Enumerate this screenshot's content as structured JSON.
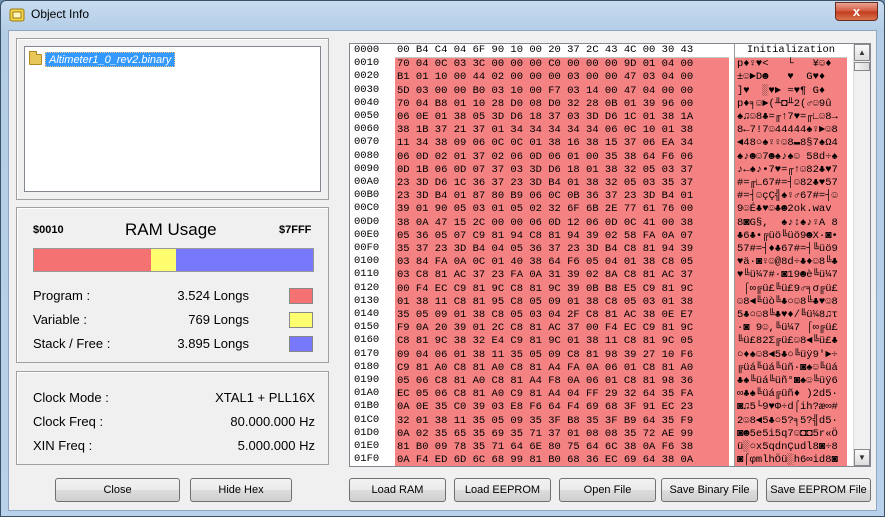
{
  "window": {
    "title": "Object Info",
    "close_glyph": "x"
  },
  "tree": {
    "item_label": "Altimeter1_0_rev2.binary"
  },
  "ram": {
    "start": "$0010",
    "title": "RAM Usage",
    "end": "$7FFF",
    "usage": {
      "program": 0.42,
      "variable": 0.09,
      "stack": 0.49
    },
    "colors": {
      "program": "#f47272",
      "variable": "#fdfd6e",
      "stack": "#7878fc"
    },
    "rows": [
      {
        "label": "Program :",
        "value": "3.524 Longs"
      },
      {
        "label": "Variable :",
        "value": "769 Longs"
      },
      {
        "label": "Stack / Free :",
        "value": "3.895 Longs"
      }
    ]
  },
  "clock": {
    "rows": [
      {
        "label": "Clock Mode :",
        "value": "XTAL1 + PLL16X"
      },
      {
        "label": "Clock Freq :",
        "value": "80.000.000 Hz"
      },
      {
        "label": "XIN Freq :",
        "value": "5.000.000 Hz"
      }
    ]
  },
  "hex": {
    "ascii_header": "Initialization",
    "rows": [
      {
        "addr": "0000",
        "bytes": "00 B4 C4 04 6F 90 10 00 20 37 2C 43 4C 00 30 43",
        "ascii": ""
      },
      {
        "addr": "0010",
        "bytes": "70 04 0C 03 3C 00 00 00 C0 00 00 00 9D 01 04 00",
        "ascii": "p♦♀♥<   └   ¥☺♦ "
      },
      {
        "addr": "0020",
        "bytes": "B1 01 10 00 44 02 00 00 00 03 00 00 47 03 04 00",
        "ascii": "±☺►D☻   ♥  G♥♦ "
      },
      {
        "addr": "0030",
        "bytes": "5D 03 00 00 B0 03 10 00 F7 03 14 00 47 04 00 00",
        "ascii": "]♥  ░♥► ≈♥¶ G♦  "
      },
      {
        "addr": "0040",
        "7": "",
        "bytes": "70 04 B8 01 10 28 D0 08 D0 32 28 0B 01 39 96 00",
        "ascii": "p♦╕☺►(╨◘╨2(♂☺9û "
      },
      {
        "addr": "0050",
        "bytes": "06 0E 01 38 05 3D D6 18 37 03 3D D6 1C 01 38 1A",
        "ascii": "♠♫☺8♣=╓↑7♥=╓∟☺8→"
      },
      {
        "addr": "0060",
        "bytes": "38 1B 37 21 37 01 34 34 34 34 34 06 0C 10 01 38",
        "ascii": "8←7!7☺44444♠♀►☺8"
      },
      {
        "addr": "0070",
        "bytes": "11 34 38 09 06 0C 0C 01 38 16 38 15 37 06 EA 34",
        "ascii": "◄48○♠♀♀☺8▬8§7♠Ω4"
      },
      {
        "addr": "0080",
        "bytes": "06 0D 02 01 37 02 06 0D 06 01 00 35 38 64 F6 06",
        "ascii": "♠♪☻☺7☻♠♪♠☺ 58d÷♠"
      },
      {
        "addr": "0090",
        "bytes": "0D 1B 06 0D 07 37 03 3D D6 18 01 38 32 05 03 37",
        "ascii": "♪←♠♪•7♥=╓↑☺82♣♥7"
      },
      {
        "addr": "00A0",
        "bytes": "23 3D D6 1C 36 37 23 3D B4 01 38 32 05 03 35 37",
        "ascii": "#=╓∟67#=┤☺82♣♥57"
      },
      {
        "addr": "00B0",
        "bytes": "23 3D B4 01 87 80 B9 06 0C 0B 36 37 23 3D B4 01",
        "ascii": "#=┤☺çÇ╣♠♀♂67#=┤☺"
      },
      {
        "addr": "00C0",
        "bytes": "39 01 90 05 03 01 05 02 32 6F 6B 2E 77 61 76 00",
        "ascii": "9☺É♣♥☺♣☻2ok.wav "
      },
      {
        "addr": "00D0",
        "bytes": "38 0A 47 15 2C 00 00 06 0D 12 06 0D 0C 41 00 38",
        "ascii": "8◙G§,  ♠♪↕♠♪♀A 8"
      },
      {
        "addr": "00E0",
        "bytes": "05 36 05 07 C9 81 94 C8 81 94 39 02 58 FA 0A 07",
        "ascii": "♣6♣•╔üö╚üö9☻X·◙•"
      },
      {
        "addr": "00F0",
        "bytes": "35 37 23 3D B4 04 05 36 37 23 3D B4 C8 81 94 39",
        "ascii": "57#=┤♦♣67#=┤╚üö9"
      },
      {
        "addr": "0100",
        "bytes": "03 84 FA 0A 0C 01 40 38 64 F6 05 04 01 38 C8 05",
        "ascii": "♥ä·◙♀☺@8d÷♣♦☺8╚♣"
      },
      {
        "addr": "0110",
        "bytes": "03 C8 81 AC 37 23 FA 0A 31 39 02 8A C8 81 AC 37",
        "ascii": "♥╚ü¼7#·◙19☻è╚ü¼7"
      },
      {
        "addr": "0120",
        "bytes": "00 F4 EC C9 81 9C C8 81 9C 39 0B B8 E5 C9 81 9C",
        "ascii": " ⌠∞╔ü£╚ü£9♂╕σ╔ü£"
      },
      {
        "addr": "0130",
        "bytes": "01 38 11 C8 81 95 C8 05 09 01 38 C8 05 03 01 38",
        "ascii": "☺8◄╚üò╚♣○☺8╚♣♥☺8"
      },
      {
        "addr": "0140",
        "bytes": "35 05 09 01 38 C8 05 03 04 2F C8 81 AC 38 0E E7",
        "ascii": "5♣○☺8╚♣♥♦/╚ü¼8♫τ"
      },
      {
        "addr": "0150",
        "bytes": "F9 0A 20 39 01 2C C8 81 AC 37 00 F4 EC C9 81 9C",
        "ascii": "∙◙ 9☺,╚ü¼7 ⌠∞╔ü£"
      },
      {
        "addr": "0160",
        "bytes": "C8 81 9C 38 32 E4 C9 81 9C 01 38 11 C8 81 9C 05",
        "ascii": "╚ü£82Σ╔ü£☺8◄╚ü£♣"
      },
      {
        "addr": "0170",
        "bytes": "09 04 06 01 38 11 35 05 09 C8 81 98 39 27 10 F6",
        "ascii": "○♦♠☺8◄5♣○╚üÿ9'►÷"
      },
      {
        "addr": "0180",
        "bytes": "C9 81 A0 C8 81 A0 C8 81 A4 FA 0A 06 01 C8 81 A0",
        "ascii": "╔üá╚üá╚üñ·◙♠☺╚üá"
      },
      {
        "addr": "0190",
        "bytes": "05 06 C8 81 A0 C8 81 A4 F8 0A 06 01 C8 81 98 36",
        "ascii": "♣♠╚üá╚üñ°◙♠☺╚üÿ6"
      },
      {
        "addr": "01A0",
        "bytes": "EC 05 06 C8 81 A0 C9 81 A4 04 FF 29 32 64 35 FA",
        "ascii": "∞♣♠╚üá╔üñ♦ )2d5·"
      },
      {
        "addr": "01B0",
        "bytes": "0A 0E 35 C0 39 03 E8 F6 64 F4 69 68 3F 91 EC 23",
        "ascii": "◙♫5└9♥Φ÷d⌠ih?æ∞#"
      },
      {
        "addr": "01C0",
        "bytes": "32 01 38 11 35 05 09 35 3F B8 35 3F B9 64 35 F9",
        "ascii": "2☺8◄5♣○5?╕5?╣d5∙"
      },
      {
        "addr": "01D0",
        "bytes": "0A 02 35 65 35 69 35 71 37 01 08 08 35 72 AE 99",
        "ascii": "◙☻5e5i5q7☺◘◘5r«Ö"
      },
      {
        "addr": "01E0",
        "bytes": "81 B0 09 78 35 71 64 6E 80 75 64 6C 38 0A F6 38",
        "ascii": "ü░○x5qdnÇudl8◙÷8"
      },
      {
        "addr": "01F0",
        "bytes": "0A F4 ED 6D 6C 68 99 81 B0 68 36 EC 69 64 38 0A",
        "ascii": "◙⌠φmlhÖü░h6∞id8◙"
      }
    ]
  },
  "buttons": {
    "close": "Close",
    "hide_hex": "Hide Hex",
    "load_ram": "Load RAM",
    "load_eeprom": "Load EEPROM",
    "open_file": "Open File",
    "save_binary": "Save Binary File",
    "save_eeprom": "Save EEPROM File"
  }
}
